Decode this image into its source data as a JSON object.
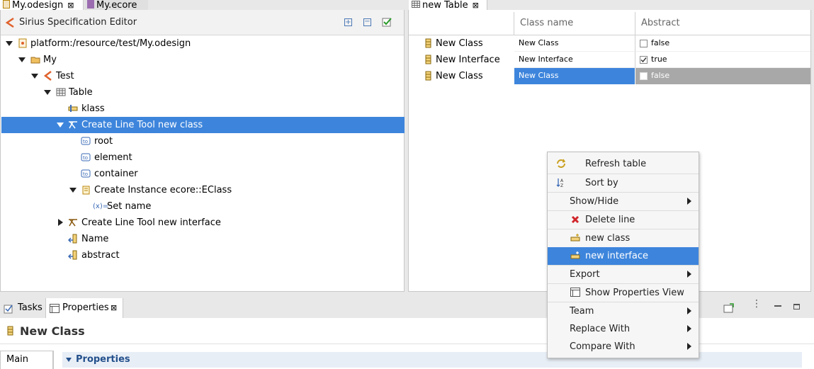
{
  "editor_tabs": [
    {
      "label": "My.odesign",
      "active": true
    },
    {
      "label": "My.ecore",
      "active": false
    }
  ],
  "editor_title": "Sirius Specification Editor",
  "tree": [
    {
      "label": "platform:/resource/test/My.odesign",
      "icon": "odesign-file-icon"
    },
    {
      "label": "My",
      "icon": "viewpoint-folder-icon"
    },
    {
      "label": "Test",
      "icon": "viewpoint-icon"
    },
    {
      "label": "Table",
      "icon": "table-icon"
    },
    {
      "label": "klass",
      "icon": "line-mapping-icon"
    },
    {
      "label": "Create Line Tool new class",
      "icon": "create-tool-icon",
      "selected": true
    },
    {
      "label": "root",
      "icon": "variable-icon"
    },
    {
      "label": "element",
      "icon": "variable-icon"
    },
    {
      "label": "container",
      "icon": "variable-icon"
    },
    {
      "label": "Create Instance ecore::EClass",
      "icon": "create-instance-icon"
    },
    {
      "label": "Set name",
      "icon": "set-value-icon"
    },
    {
      "label": "Create Line Tool new interface",
      "icon": "create-tool-icon"
    },
    {
      "label": "Name",
      "icon": "column-mapping-icon"
    },
    {
      "label": "abstract",
      "icon": "column-mapping-icon"
    }
  ],
  "table_tab": {
    "label": "new Table"
  },
  "table": {
    "headers": [
      "Class name",
      "Abstract"
    ],
    "rows": [
      {
        "label": "New Class",
        "name": "New Class",
        "abstract": "false",
        "checked": false
      },
      {
        "label": "New Interface",
        "name": "New Interface",
        "abstract": "true",
        "checked": true
      },
      {
        "label": "New Class",
        "name": "New Class",
        "abstract": "false",
        "checked": false,
        "selected": true
      }
    ]
  },
  "context_menu": [
    {
      "label": "Refresh table",
      "icon": "refresh-icon"
    },
    {
      "label": "Sort by",
      "icon": "sort-icon"
    },
    {
      "label": "Show/Hide",
      "submenu": true
    },
    {
      "label": "Delete line",
      "icon": "delete-icon"
    },
    {
      "label": "new class",
      "icon": "new-line-icon"
    },
    {
      "label": "new interface",
      "icon": "new-line-icon",
      "highlighted": true
    },
    {
      "label": "Export",
      "submenu": true
    },
    {
      "label": "Show Properties View",
      "icon": "properties-icon"
    },
    {
      "label": "Team",
      "submenu": true
    },
    {
      "label": "Replace With",
      "submenu": true
    },
    {
      "label": "Compare With",
      "submenu": true
    }
  ],
  "bottom_tabs": [
    {
      "label": "Tasks",
      "active": false
    },
    {
      "label": "Properties",
      "active": true
    }
  ],
  "properties": {
    "title": "New Class",
    "side_tab": "Main",
    "section": "Properties"
  },
  "colors": {
    "selection": "#3d85dc",
    "table_selection_gray": "#a8a8a8",
    "sirius_orange": "#e0622c",
    "properties_blue": "#23508c"
  }
}
